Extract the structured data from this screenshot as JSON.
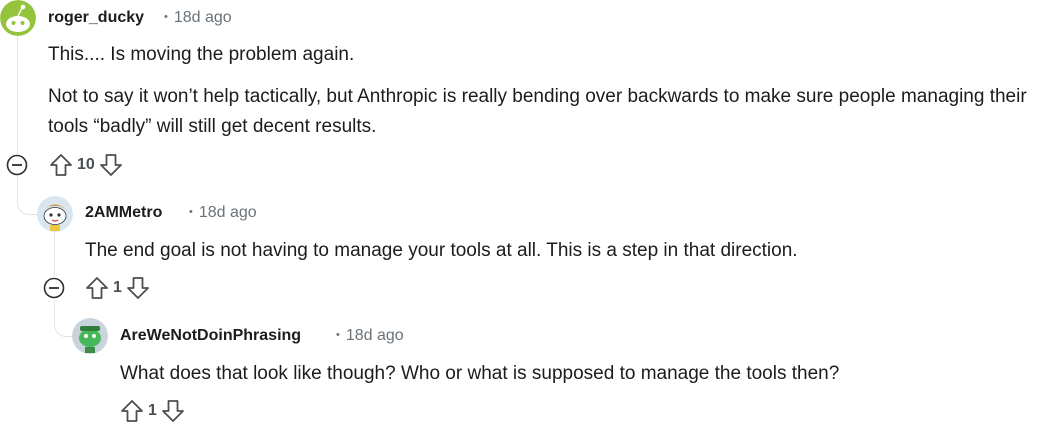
{
  "comments": [
    {
      "author": "roger_ducky",
      "time": "18d ago",
      "paragraphs": [
        "This.... Is moving the problem again.",
        "Not to say it won’t help tactically, but Anthropic is really bending over backwards to make sure people managing their tools “badly” will still get decent results."
      ],
      "votes": "10",
      "avatar_color": "#94c43b"
    },
    {
      "author": "2AMMetro",
      "time": "18d ago",
      "paragraphs": [
        "The end goal is not having to manage your tools at all. This is a step in that direction."
      ],
      "votes": "1",
      "avatar_color": "#d9e6ef"
    },
    {
      "author": "AreWeNotDoinPhrasing",
      "time": "18d ago",
      "paragraphs": [
        "What does that look like though? Who or what is supposed to manage the tools then?"
      ],
      "votes": "1",
      "avatar_color": "#c8d3db"
    }
  ],
  "meta_separator": "•",
  "colors": {
    "thread_line": "#dfe3e6",
    "meta_text": "#6a7278",
    "text": "#1c1c1c"
  }
}
